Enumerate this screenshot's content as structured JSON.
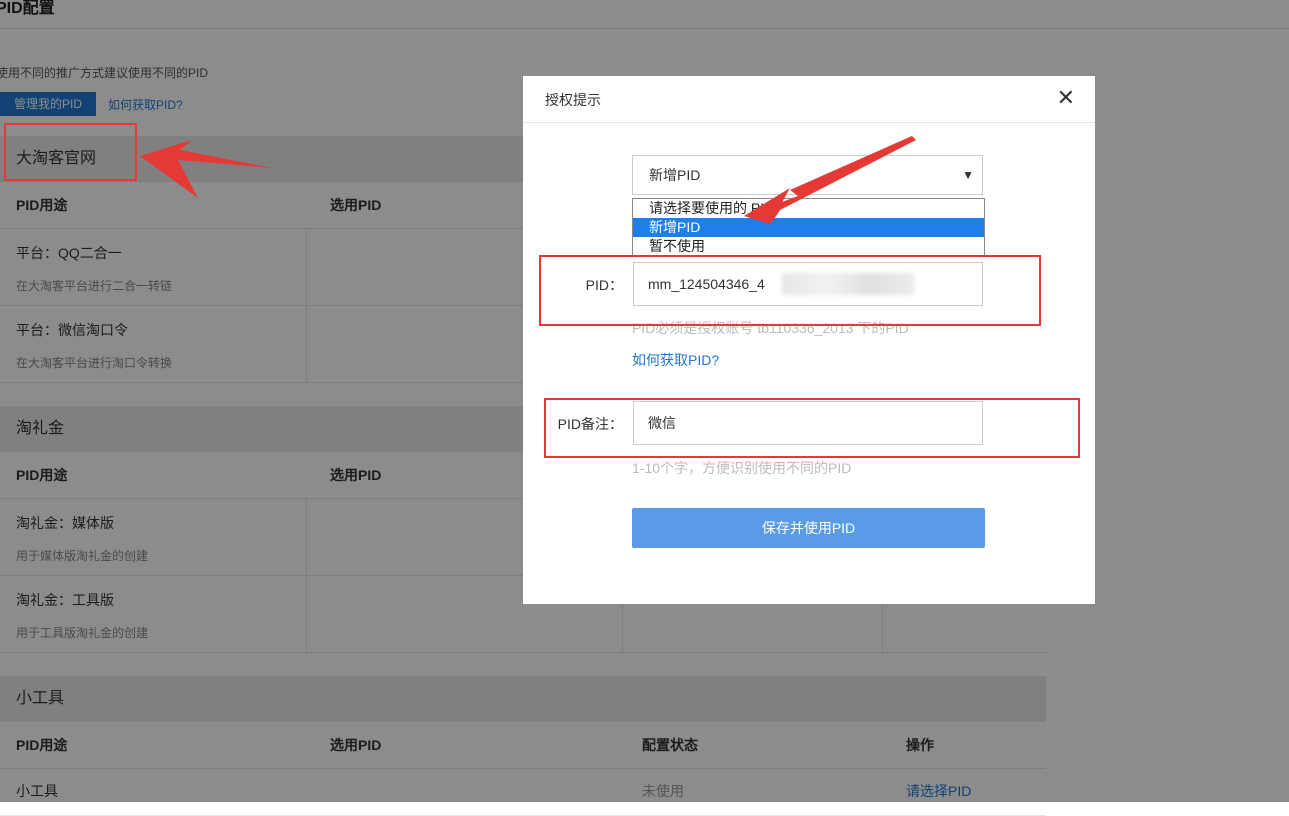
{
  "page": {
    "title": "PID配置",
    "hint": "使用不同的推广方式建议使用不同的PID",
    "manage_button": "管理我的PID",
    "how_link": "如何获取PID?"
  },
  "sections": [
    {
      "title": "大淘客官网",
      "columns": [
        "PID用途",
        "选用PID",
        "",
        ""
      ],
      "rows": [
        {
          "title": "平台：QQ二合一",
          "desc": "在大淘客平台进行二合一转链"
        },
        {
          "title": "平台：微信淘口令",
          "desc": "在大淘客平台进行淘口令转换"
        }
      ]
    },
    {
      "title": "淘礼金",
      "columns": [
        "PID用途",
        "选用PID",
        "",
        ""
      ],
      "rows": [
        {
          "title": "淘礼金：媒体版",
          "desc": "用于媒体版淘礼金的创建"
        },
        {
          "title": "淘礼金：工具版",
          "desc": "用于工具版淘礼金的创建"
        }
      ]
    },
    {
      "title": "小工具",
      "columns": [
        "PID用途",
        "选用PID",
        "配置状态",
        "操作"
      ],
      "rows": [
        {
          "title": "小工具",
          "status": "未使用",
          "action": "请选择PID"
        }
      ]
    }
  ],
  "modal": {
    "title": "授权提示",
    "close_icon": "close-icon",
    "select": {
      "value": "新增PID",
      "options": [
        "请选择要使用的 PID",
        "新增PID",
        "暂不使用"
      ],
      "selected_index": 1
    },
    "pid_label": "PID：",
    "pid_value": "mm_124504346_4",
    "pid_note": "PID必须是授权账号 tb110336_2013 下的PID",
    "how_link": "如何获取PID?",
    "remark_label": "PID备注：",
    "remark_value": "微信",
    "remark_note": "1-10个字，方便识别使用不同的PID",
    "save_button": "保存并使用PID"
  },
  "colors": {
    "accent": "#1f78d1",
    "save_button": "#5a9be8",
    "highlight_red": "#e53935",
    "option_selected": "#1e7fe8"
  }
}
